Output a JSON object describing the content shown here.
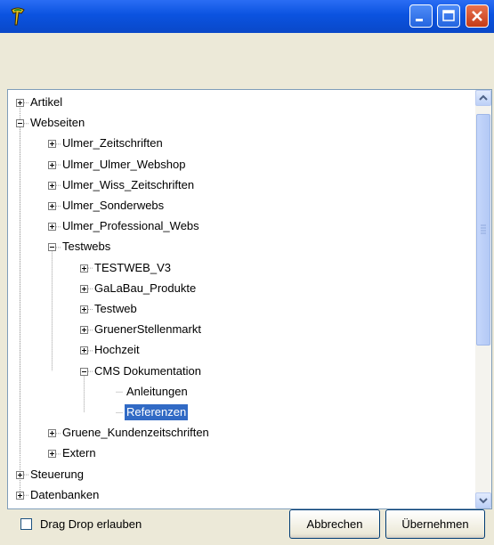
{
  "window": {
    "title": "",
    "colors": {
      "titlebar": "#0a48c8",
      "selection": "#316ac5",
      "close_button": "#c53b17"
    }
  },
  "tree": {
    "items": [
      {
        "label": "Artikel",
        "depth": 0,
        "state": "collapsed"
      },
      {
        "label": "Webseiten",
        "depth": 0,
        "state": "expanded"
      },
      {
        "label": "Ulmer_Zeitschriften",
        "depth": 1,
        "state": "collapsed"
      },
      {
        "label": "Ulmer_Ulmer_Webshop",
        "depth": 1,
        "state": "collapsed"
      },
      {
        "label": "Ulmer_Wiss_Zeitschriften",
        "depth": 1,
        "state": "collapsed"
      },
      {
        "label": "Ulmer_Sonderwebs",
        "depth": 1,
        "state": "collapsed"
      },
      {
        "label": "Ulmer_Professional_Webs",
        "depth": 1,
        "state": "collapsed"
      },
      {
        "label": "Testwebs",
        "depth": 1,
        "state": "expanded"
      },
      {
        "label": "TESTWEB_V3",
        "depth": 2,
        "state": "collapsed"
      },
      {
        "label": "GaLaBau_Produkte",
        "depth": 2,
        "state": "collapsed"
      },
      {
        "label": "Testweb",
        "depth": 2,
        "state": "collapsed"
      },
      {
        "label": "GruenerStellenmarkt",
        "depth": 2,
        "state": "collapsed"
      },
      {
        "label": "Hochzeit",
        "depth": 2,
        "state": "collapsed"
      },
      {
        "label": "CMS Dokumentation",
        "depth": 2,
        "state": "expanded"
      },
      {
        "label": "Anleitungen",
        "depth": 3,
        "state": "leaf"
      },
      {
        "label": "Referenzen",
        "depth": 3,
        "state": "leaf",
        "selected": true
      },
      {
        "label": "Gruene_Kundenzeitschriften",
        "depth": 1,
        "state": "collapsed"
      },
      {
        "label": "Extern",
        "depth": 1,
        "state": "collapsed"
      },
      {
        "label": "Steuerung",
        "depth": 0,
        "state": "collapsed"
      },
      {
        "label": "Datenbanken",
        "depth": 0,
        "state": "collapsed"
      }
    ]
  },
  "footer": {
    "checkbox_label": "Drag Drop erlauben",
    "checkbox_checked": false,
    "cancel_label": "Abbrechen",
    "apply_label": "Übernehmen"
  }
}
